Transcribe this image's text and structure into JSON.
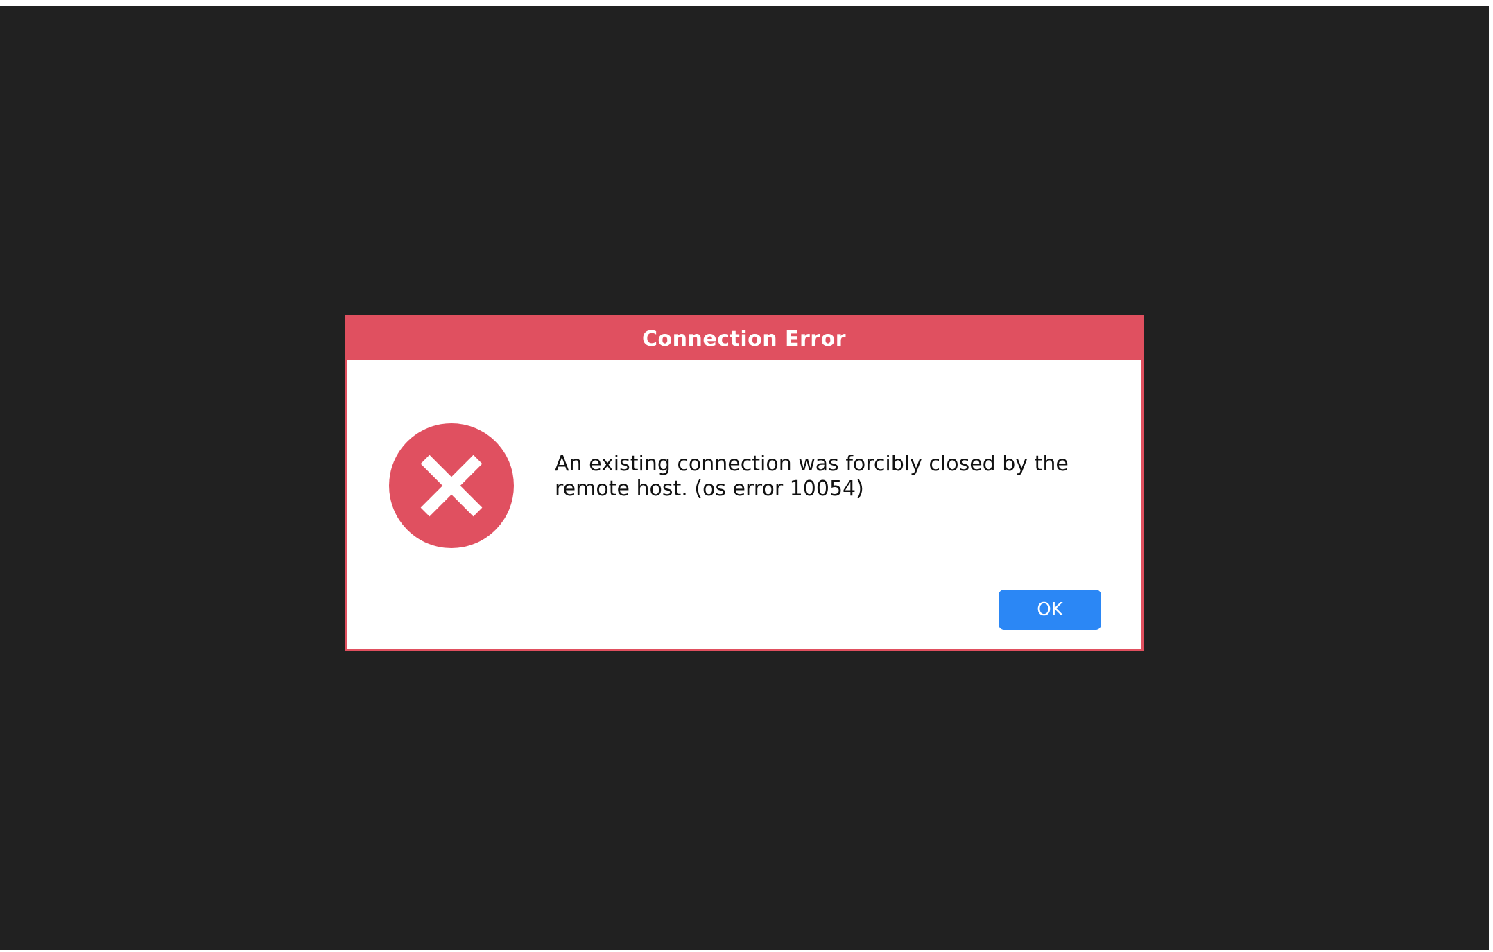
{
  "dialog": {
    "title": "Connection Error",
    "message": "An existing connection was forcibly closed by the remote host. (os error 10054)",
    "icon": "error-x-icon",
    "ok_label": "OK"
  },
  "colors": {
    "backdrop": "#212121",
    "header": "#e05060",
    "icon_circle": "#e05060",
    "ok_button": "#2b87f5"
  }
}
